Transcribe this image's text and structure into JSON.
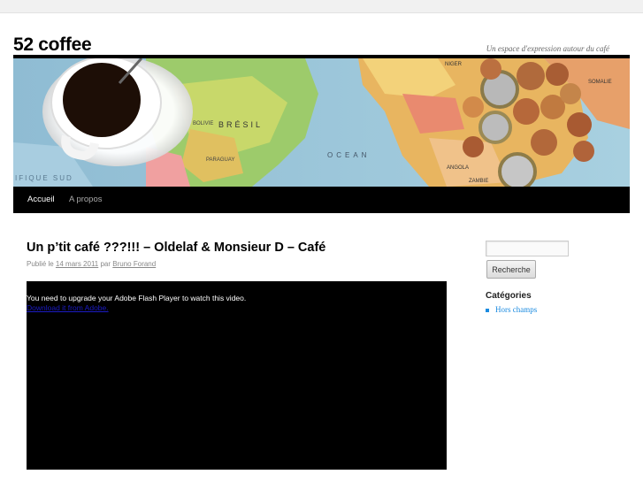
{
  "site": {
    "title": "52 coffee",
    "description": "Un espace d'expression autour du café"
  },
  "nav": {
    "items": [
      {
        "label": "Accueil"
      },
      {
        "label": "A propos"
      }
    ]
  },
  "banner": {
    "map_labels": [
      "BRÉSIL",
      "OCEAN",
      "BOLIVIE",
      "PARAGUAY",
      "IFIQUE SUD",
      "NIGER",
      "ANGOLA",
      "SOMALIE",
      "ZAMBIE"
    ]
  },
  "post": {
    "title": "Un p’tit café ???!!! – Oldelaf & Monsieur D – Café",
    "meta_published": "Publié le",
    "meta_date": "14 mars 2011",
    "meta_by": "par",
    "meta_author": "Bruno Forand",
    "video_message": "You need to upgrade your Adobe Flash Player to watch this video.",
    "video_link": "Download it from Adobe."
  },
  "sidebar": {
    "search_placeholder": "",
    "search_button": "Recherche",
    "categories_title": "Catégories",
    "categories": [
      {
        "label": "Hors champs"
      }
    ]
  }
}
